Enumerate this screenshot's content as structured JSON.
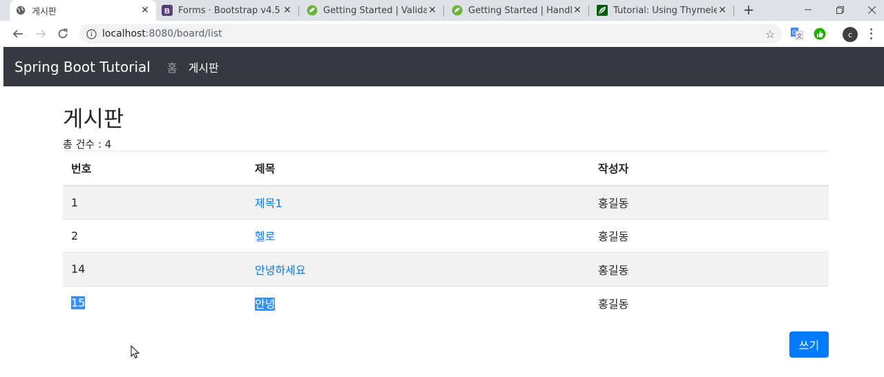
{
  "browser": {
    "tabs": [
      {
        "title": "게시판",
        "icon": "globe-icon",
        "active": true
      },
      {
        "title": "Forms · Bootstrap v4.5",
        "icon": "bootstrap-icon",
        "active": false
      },
      {
        "title": "Getting Started | Validating",
        "icon": "spring-icon",
        "active": false
      },
      {
        "title": "Getting Started | Handling",
        "icon": "spring-icon",
        "active": false
      },
      {
        "title": "Tutorial: Using Thymeleaf",
        "icon": "thymeleaf-icon",
        "active": false
      }
    ],
    "url_host": "localhost",
    "url_rest": ":8080/board/list",
    "profile_initial": "c"
  },
  "navbar": {
    "brand": "Spring Boot Tutorial",
    "links": [
      "홈",
      "게시판"
    ]
  },
  "board": {
    "title": "게시판",
    "count_label": "총 건수 : ",
    "count_value": "4",
    "headers": [
      "번호",
      "제목",
      "작성자"
    ],
    "rows": [
      {
        "num": "1",
        "title": "제목1",
        "author": "홍길동"
      },
      {
        "num": "2",
        "title": "헬로",
        "author": "홍길동"
      },
      {
        "num": "14",
        "title": "안녕하세요",
        "author": "홍길동"
      },
      {
        "num": "15",
        "title": "안녕",
        "author": "홍길동"
      }
    ],
    "write_button": "쓰기"
  },
  "colors": {
    "navbar_bg": "#343a40",
    "link": "#007bff",
    "primary_button": "#007bff",
    "selection": "#3390ff"
  }
}
